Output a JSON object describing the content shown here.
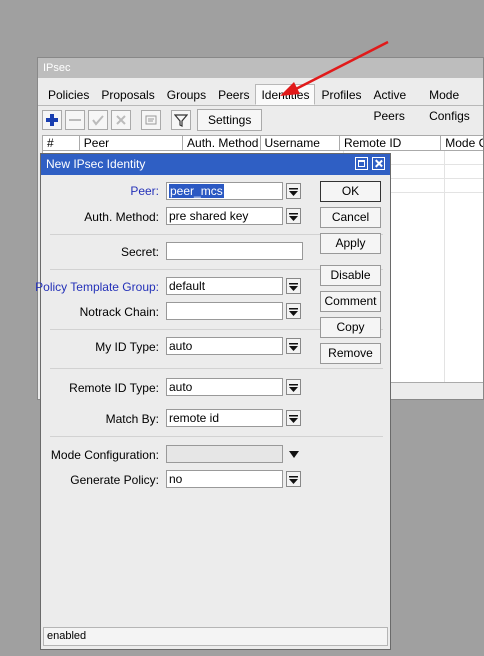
{
  "window": {
    "title": "IPsec"
  },
  "tabs": [
    "Policies",
    "Proposals",
    "Groups",
    "Peers",
    "Identities",
    "Profiles",
    "Active Peers",
    "Mode Configs"
  ],
  "active_tab": "Identities",
  "toolbar": {
    "settings_label": "Settings"
  },
  "table": {
    "columns": [
      "#",
      "Peer",
      "Auth. Method",
      "Username",
      "Remote ID",
      "Mode Co"
    ]
  },
  "dialog": {
    "title": "New IPsec Identity",
    "fields": {
      "peer": {
        "label": "Peer:",
        "value": "peer_mcs"
      },
      "auth_method": {
        "label": "Auth. Method:",
        "value": "pre shared key"
      },
      "secret": {
        "label": "Secret:",
        "value": ""
      },
      "policy_template_group": {
        "label": "Policy Template Group:",
        "value": "default"
      },
      "notrack_chain": {
        "label": "Notrack Chain:",
        "value": ""
      },
      "my_id_type": {
        "label": "My ID Type:",
        "value": "auto"
      },
      "remote_id_type": {
        "label": "Remote ID Type:",
        "value": "auto"
      },
      "match_by": {
        "label": "Match By:",
        "value": "remote id"
      },
      "mode_configuration": {
        "label": "Mode Configuration:",
        "value": ""
      },
      "generate_policy": {
        "label": "Generate Policy:",
        "value": "no"
      }
    },
    "buttons": {
      "ok": "OK",
      "cancel": "Cancel",
      "apply": "Apply",
      "disable": "Disable",
      "comment": "Comment",
      "copy": "Copy",
      "remove": "Remove"
    },
    "status": "enabled"
  },
  "colors": {
    "dialog_title": "#2f5fc4",
    "blue_label": "#2431b8",
    "arrow": "#e11a1a",
    "selection": "#2b59c3"
  }
}
